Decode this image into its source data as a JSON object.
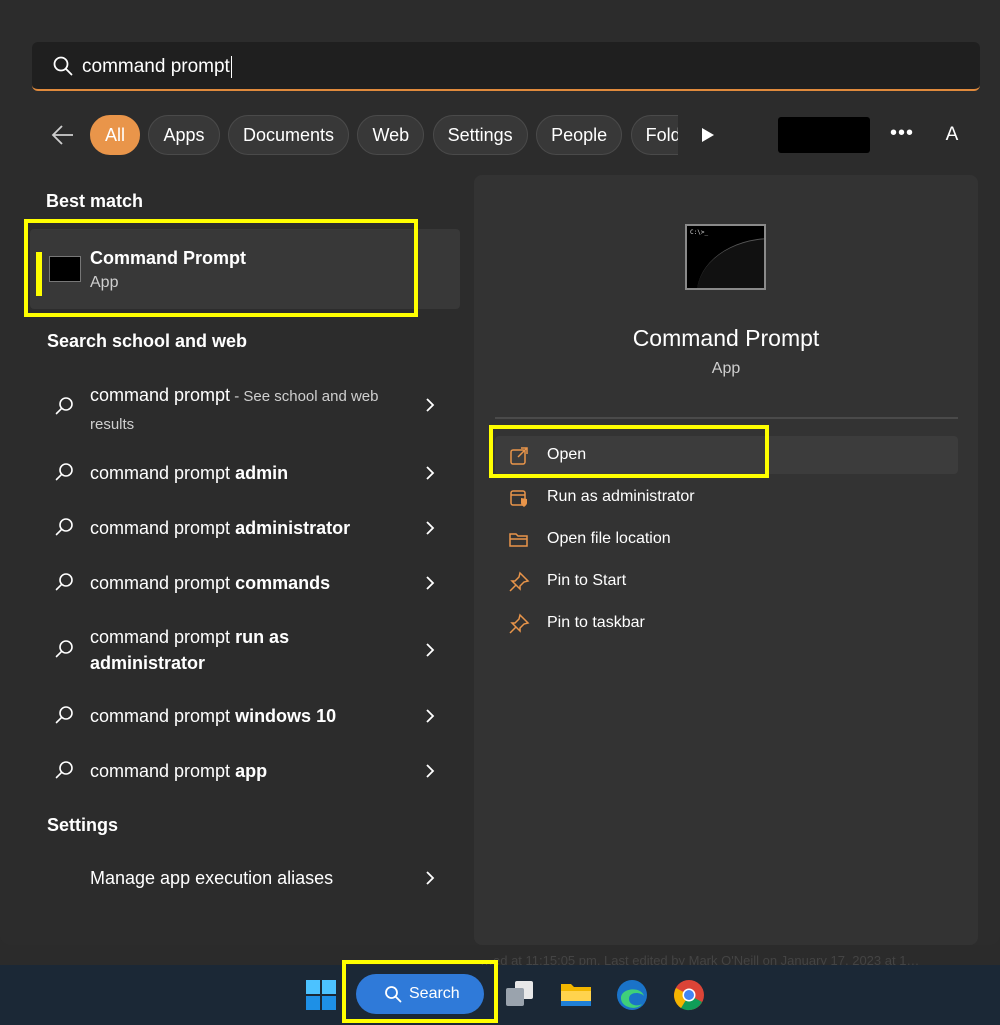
{
  "search": {
    "value": "command prompt"
  },
  "filters": {
    "chips": [
      {
        "label": "All",
        "active": true
      },
      {
        "label": "Apps",
        "active": false
      },
      {
        "label": "Documents",
        "active": false
      },
      {
        "label": "Web",
        "active": false
      },
      {
        "label": "Settings",
        "active": false
      },
      {
        "label": "People",
        "active": false
      },
      {
        "label": "Folders",
        "active": false
      }
    ],
    "more_label": "•••",
    "account_initial": "A"
  },
  "best_match": {
    "heading": "Best match",
    "title": "Command Prompt",
    "subtitle": "App"
  },
  "web_section": {
    "heading": "Search school and web",
    "results": [
      {
        "prefix": "command prompt",
        "bold": "",
        "hint": " - See school and web results"
      },
      {
        "prefix": "command prompt ",
        "bold": "admin",
        "hint": ""
      },
      {
        "prefix": "command prompt ",
        "bold": "administrator",
        "hint": ""
      },
      {
        "prefix": "command prompt ",
        "bold": "commands",
        "hint": ""
      },
      {
        "prefix": "command prompt ",
        "bold": "run as administrator",
        "hint": ""
      },
      {
        "prefix": "command prompt ",
        "bold": "windows 10",
        "hint": ""
      },
      {
        "prefix": "command prompt ",
        "bold": "app",
        "hint": ""
      }
    ]
  },
  "settings_section": {
    "heading": "Settings",
    "items": [
      {
        "label": "Manage app execution aliases"
      }
    ]
  },
  "detail": {
    "icon_prompt": "C:\\>_",
    "title": "Command Prompt",
    "subtitle": "App",
    "actions": [
      {
        "label": "Open",
        "icon": "open-external-icon"
      },
      {
        "label": "Run as administrator",
        "icon": "run-as-admin-icon"
      },
      {
        "label": "Open file location",
        "icon": "folder-icon"
      },
      {
        "label": "Pin to Start",
        "icon": "pin-icon"
      },
      {
        "label": "Pin to taskbar",
        "icon": "pin-icon"
      }
    ]
  },
  "taskbar": {
    "search_label": "Search",
    "background_text": "…ed at 11:15:05 pm. Last edited by Mark O'Neill on January 17, 2023 at 1…"
  },
  "colors": {
    "accent": "#e9954a",
    "highlight": "#ffff00",
    "taskbar_search": "#2f7ad9"
  }
}
